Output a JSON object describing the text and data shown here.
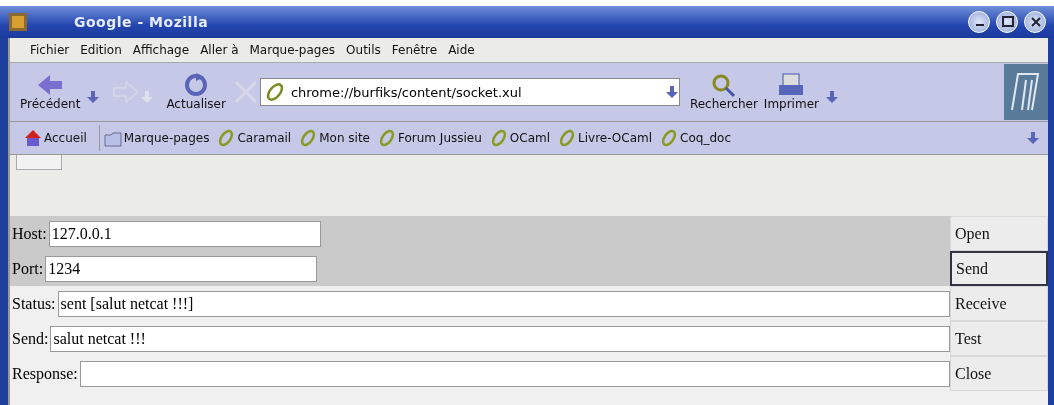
{
  "window": {
    "title": "Google - Mozilla"
  },
  "menu": [
    "Fichier",
    "Edition",
    "Affichage",
    "Aller à",
    "Marque-pages",
    "Outils",
    "Fenêtre",
    "Aide"
  ],
  "nav_toolbar": {
    "items": [
      {
        "kind": "back",
        "label": "Précédent",
        "disabled": false
      },
      {
        "kind": "forward",
        "disabled": true
      },
      {
        "kind": "reload",
        "label": "Actualiser",
        "disabled": false
      },
      {
        "kind": "stop",
        "disabled": true
      }
    ],
    "address": "chrome://burfiks/content/socket.xul",
    "right_items": [
      {
        "kind": "search",
        "label": "Rechercher"
      },
      {
        "kind": "print",
        "label": "Imprimer"
      }
    ]
  },
  "bookmarks": [
    {
      "kind": "home",
      "label": "Accueil"
    },
    {
      "kind": "folder",
      "label": "Marque-pages"
    },
    {
      "kind": "link",
      "label": "Caramail"
    },
    {
      "kind": "link",
      "label": "Mon site"
    },
    {
      "kind": "link",
      "label": "Forum Jussieu"
    },
    {
      "kind": "link",
      "label": "OCaml"
    },
    {
      "kind": "link",
      "label": "Livre-OCaml"
    },
    {
      "kind": "link",
      "label": "Coq_doc"
    }
  ],
  "form": {
    "fields": [
      {
        "label": "Host:",
        "value": "127.0.0.1",
        "kind": "short"
      },
      {
        "label": "Port:",
        "value": "1234",
        "kind": "short"
      },
      {
        "label": "Status:",
        "value": "sent [salut netcat !!!]",
        "kind": "wide"
      },
      {
        "label": "Send:",
        "value": "salut netcat !!!",
        "kind": "wide"
      },
      {
        "label": "Response:",
        "kind": "wide"
      }
    ],
    "buttons": [
      {
        "label": "Open",
        "focused": false
      },
      {
        "label": "Send",
        "focused": true
      },
      {
        "label": "Receive",
        "focused": false
      },
      {
        "label": "Test",
        "focused": false
      },
      {
        "label": "Close",
        "focused": false
      }
    ]
  }
}
